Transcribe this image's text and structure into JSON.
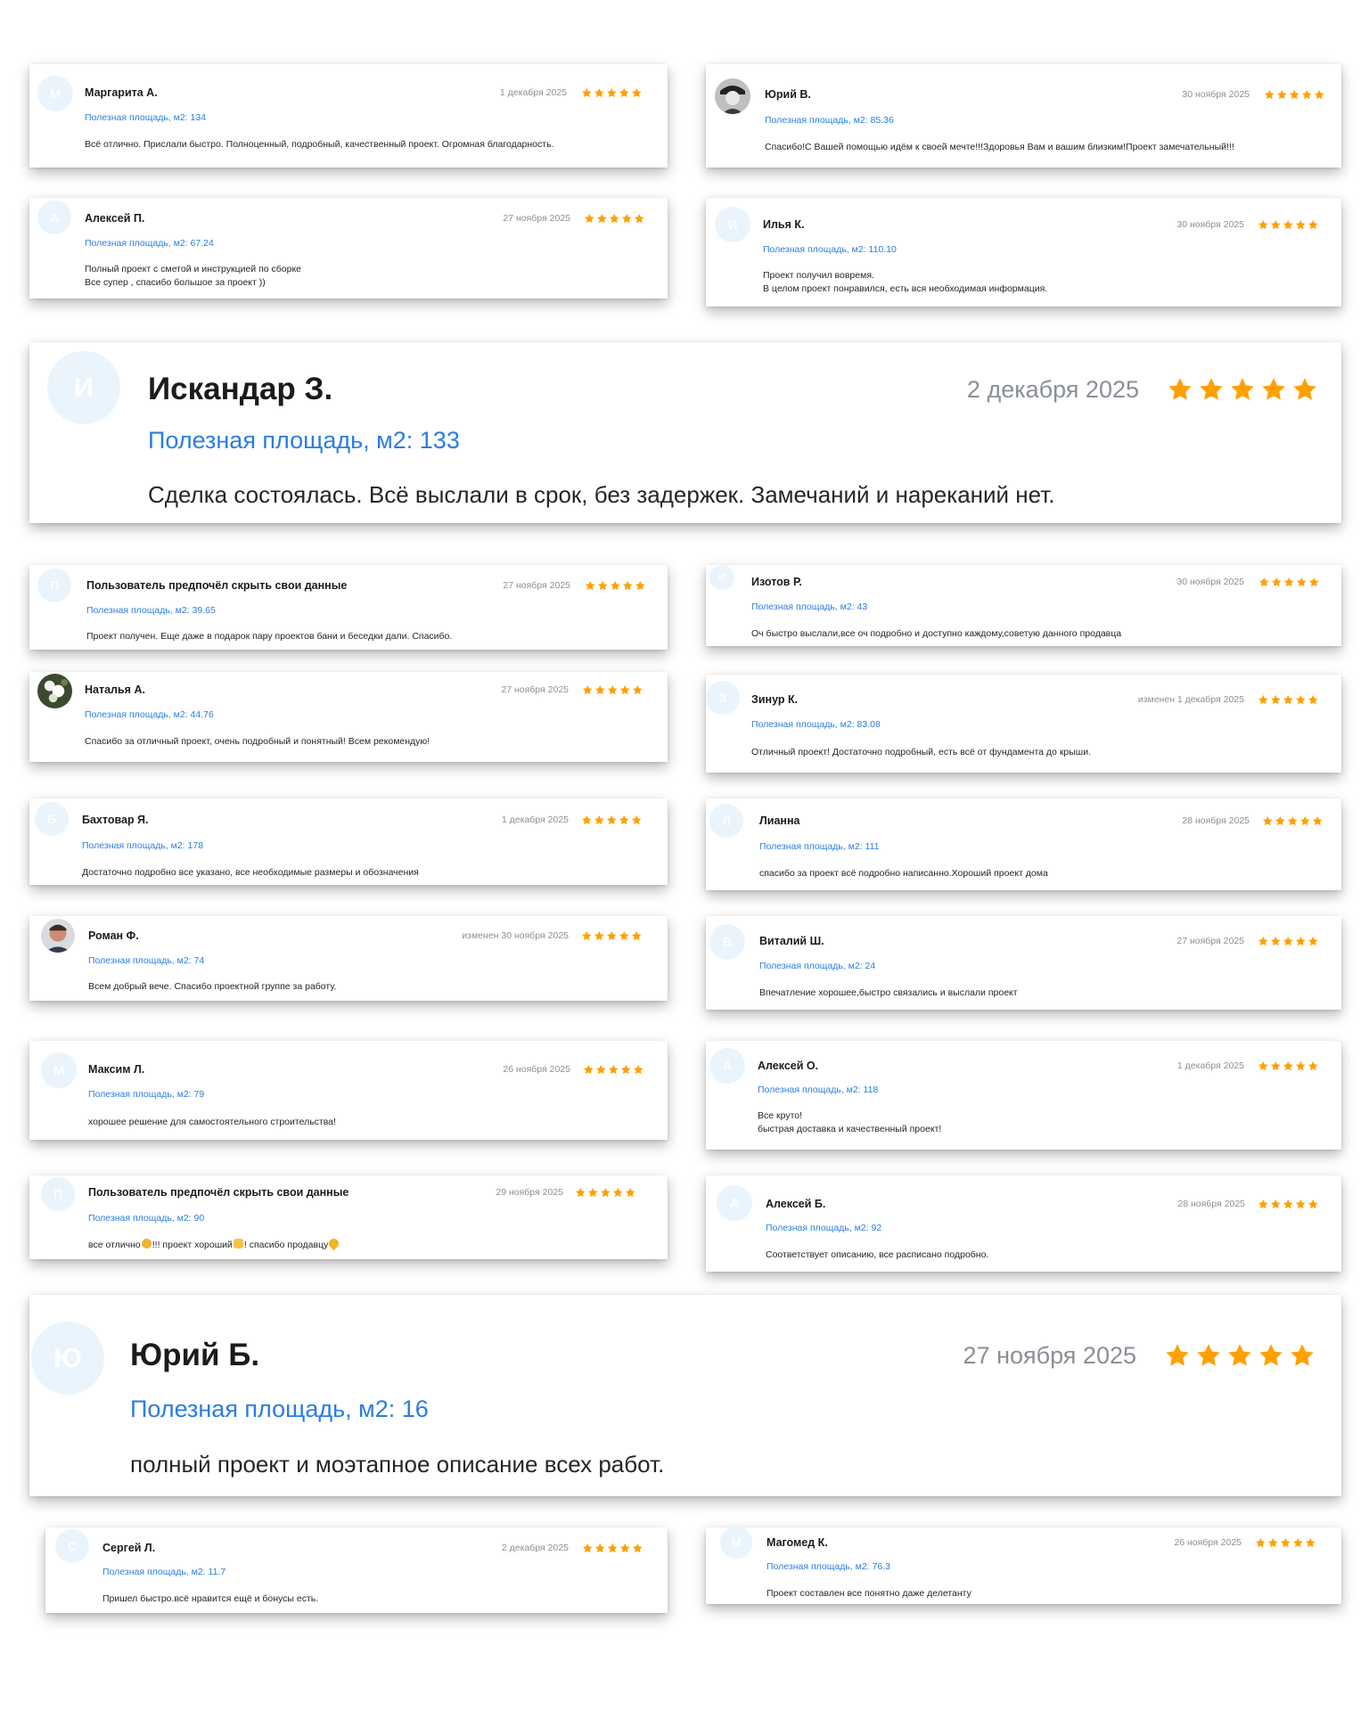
{
  "accent_color": "#2a7de1",
  "star_color": "#ffa000",
  "area_label": "Полезная площадь, м2:",
  "reviews": [
    {
      "name": "Маргарита А.",
      "date": "1 декабря 2025",
      "area": "134",
      "text": "Всё отлично. Прислали быстро. Полноценный, подробный, качественный проект. Огромная благодарность.",
      "initial": "М",
      "rating": 5
    },
    {
      "name": "Юрий В.",
      "date": "30 ноября 2025",
      "area": "85.36",
      "text": "Спасибо!С Вашей помощью идём к своей мечте!!!Здоровья Вам и вашим близким!Проект замечательный!!!",
      "initial": "",
      "avatar_icon": "person-photo-icon",
      "rating": 5
    },
    {
      "name": "Алексей П.",
      "date": "27 ноября 2025",
      "area": "67.24",
      "text": "Полный проект с сметой и инструкцией по сборке\nВсе супер , спасибо большое за проект ))",
      "initial": "А",
      "rating": 5
    },
    {
      "name": "Илья К.",
      "date": "30 ноября 2025",
      "area": "110.10",
      "text": "Проект получил вовремя.\nВ целом проект понравился, есть вся необходимая информация.",
      "initial": "И",
      "rating": 5
    },
    {
      "name": "Искандар З.",
      "date": "2 декабря 2025",
      "area": "133",
      "text": "Сделка состоялась. Всё выслали в срок, без задержек. Замечаний и нареканий нет.",
      "initial": "И",
      "rating": 5
    },
    {
      "name": "Пользователь предпочёл скрыть свои данные",
      "date": "27 ноября 2025",
      "area": "39.65",
      "text": "Проект получен. Еще даже в подарок пару проектов бани и беседки дали. Спасибо.",
      "initial": "П",
      "rating": 5
    },
    {
      "name": "Изотов Р.",
      "date": "30 ноября 2025",
      "area": "43",
      "text": "Оч быстро выслали,все оч подробно и доступно каждому,советую данного продавца",
      "initial": "И",
      "rating": 5
    },
    {
      "name": "Наталья А.",
      "date": "27 ноября 2025",
      "area": "44.76",
      "text": "Спасибо за отличный проект, очень подробный и понятный! Всем рекомендую!",
      "initial": "",
      "avatar_icon": "flower-photo-icon",
      "rating": 5
    },
    {
      "name": "Зинур К.",
      "date": "изменен 1 декабря 2025",
      "area": "83.08",
      "text": "Отличный проект! Достаточно подробный, есть всё от фундамента до крыши.",
      "initial": "З",
      "rating": 5
    },
    {
      "name": "Бахтовар Я.",
      "date": "1 декабря 2025",
      "area": "178",
      "text": "Достаточно подробно все указано, все необходимые размеры и обозначения",
      "initial": "Б",
      "rating": 5
    },
    {
      "name": "Лианна",
      "date": "28 ноября 2025",
      "area": "111",
      "text": "спасибо за проект всё подробно написанно.Хороший проект дома",
      "initial": "Л",
      "rating": 5
    },
    {
      "name": "Роман Ф.",
      "date": "изменен 30 ноября 2025",
      "area": "74",
      "text": "Всем добрый вече. Спасибо проектной группе за работу.",
      "initial": "",
      "avatar_icon": "man-photo-icon",
      "rating": 5
    },
    {
      "name": "Виталий Ш.",
      "date": "27 ноября 2025",
      "area": "24",
      "text": "Впечатление хорошее,быстро связались и выслали проект",
      "initial": "В",
      "rating": 5
    },
    {
      "name": "Максим Л.",
      "date": "26 ноября 2025",
      "area": "79",
      "text": "хорошее решение для самостоятельного строительства!",
      "initial": "М",
      "rating": 5
    },
    {
      "name": "Алексей О.",
      "date": "1 декабря 2025",
      "area": "118",
      "text": "Все круто!\nбыстрая доставка и качественный проект!",
      "initial": "А",
      "rating": 5
    },
    {
      "name": "Пользователь предпочёл скрыть свои данные",
      "date": "29 ноября 2025",
      "area": "90",
      "text_parts": [
        "все отлично",
        "!!! проект хороший",
        "! спасибо продавцу"
      ],
      "emojis": [
        "clapping-hands-icon",
        "thumbs-up-icon",
        "heart-icon"
      ],
      "initial": "П",
      "rating": 5
    },
    {
      "name": "Алексей Б.",
      "date": "28 ноября 2025",
      "area": "92",
      "text": "Соответствует описанию, все расписано подробно.",
      "initial": "А",
      "rating": 5
    },
    {
      "name": "Юрий Б.",
      "date": "27 ноября 2025",
      "area": "16",
      "text": "полный проект и моэтапное описание всех работ.",
      "initial": "Ю",
      "rating": 5
    },
    {
      "name": "Сергей Л.",
      "date": "2 декабря 2025",
      "area": "11.7",
      "text": "Пришел быстро.всё нравится ещё и бонусы есть.",
      "initial": "С",
      "rating": 5
    },
    {
      "name": "Магомед К.",
      "date": "26 ноября 2025",
      "area": "76.3",
      "text": "Проект составлен все понятно даже делетанту",
      "initial": "М",
      "rating": 5
    }
  ]
}
